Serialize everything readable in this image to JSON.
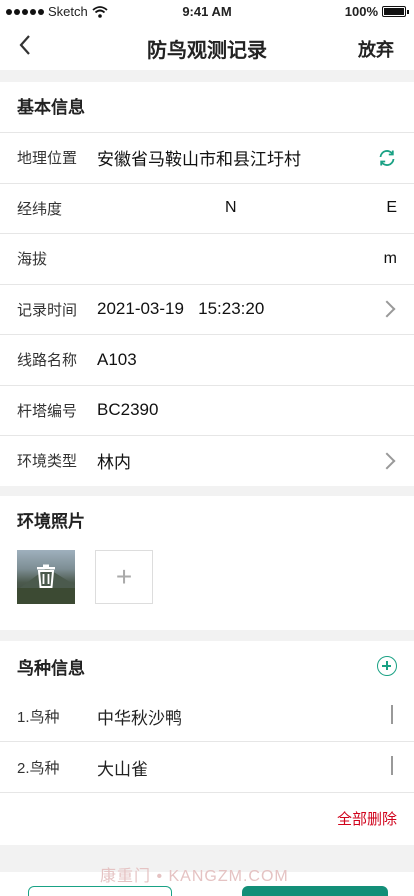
{
  "status_bar": {
    "carrier": "Sketch",
    "time": "9:41 AM",
    "battery": "100%"
  },
  "nav": {
    "title": "防鸟观测记录",
    "action": "放弃"
  },
  "basic_info": {
    "title": "基本信息",
    "location": {
      "label": "地理位置",
      "value": "安徽省马鞍山市和县江圩村"
    },
    "coords": {
      "label": "经纬度",
      "lat_unit": "N",
      "lng_unit": "E"
    },
    "altitude": {
      "label": "海拔",
      "unit": "m"
    },
    "record_time": {
      "label": "记录时间",
      "value": "2021-03-19   15:23:20"
    },
    "line_name": {
      "label": "线路名称",
      "value": "A103"
    },
    "tower_no": {
      "label": "杆塔编号",
      "value": "BC2390"
    },
    "env_type": {
      "label": "环境类型",
      "value": "林内"
    }
  },
  "env_photos": {
    "title": "环境照片"
  },
  "bird_info": {
    "title": "鸟种信息",
    "species": [
      {
        "label": "1.鸟种",
        "value": "中华秋沙鸭"
      },
      {
        "label": "2.鸟种",
        "value": "大山雀"
      }
    ],
    "delete_all": "全部删除"
  },
  "watermark": "康重门 • KANGZM.COM",
  "colors": {
    "accent": "#1aa184",
    "danger": "#d0021b"
  }
}
